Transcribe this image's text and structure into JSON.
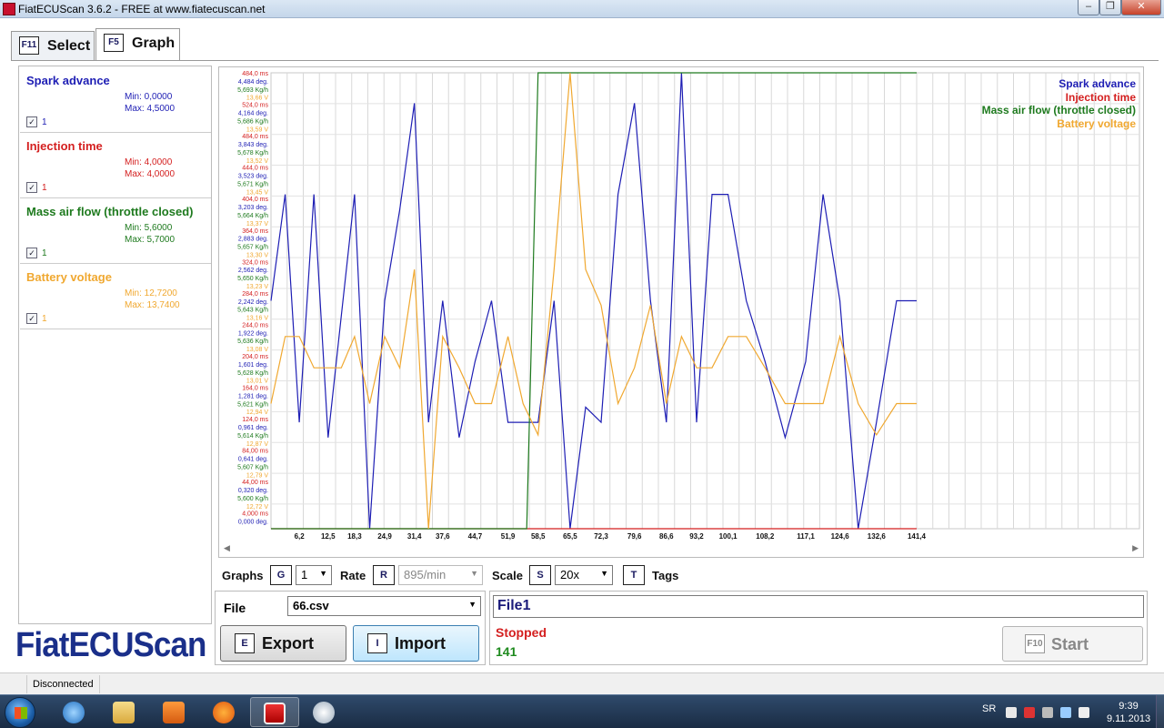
{
  "window": {
    "title": "FiatECUScan 3.6.2 - FREE at www.fiatecuscan.net"
  },
  "tabs": [
    {
      "key": "F11",
      "label": "Select"
    },
    {
      "key": "F5",
      "label": "Graph"
    }
  ],
  "signals": [
    {
      "name": "Spark advance",
      "min": "Min: 0,0000",
      "max": "Max: 4,5000",
      "checked": true,
      "count": "1",
      "color": "#1e1eb4"
    },
    {
      "name": "Injection time",
      "min": "Min: 4,0000",
      "max": "Max: 4,0000",
      "checked": true,
      "count": "1",
      "color": "#d41f1f"
    },
    {
      "name": "Mass air flow (throttle closed)",
      "min": "Min: 5,6000",
      "max": "Max: 5,7000",
      "checked": true,
      "count": "1",
      "color": "#1e7a1e"
    },
    {
      "name": "Battery voltage",
      "min": "Min: 12,7200",
      "max": "Max: 13,7400",
      "checked": true,
      "count": "1",
      "color": "#f0a830"
    }
  ],
  "chart_data": {
    "type": "line",
    "x": [
      0,
      3.1,
      6.2,
      9.4,
      12.5,
      15.4,
      18.3,
      21.6,
      24.9,
      28.2,
      31.4,
      34.5,
      37.6,
      41.2,
      44.7,
      48.3,
      51.9,
      55.2,
      58.5,
      62.0,
      65.5,
      68.9,
      72.3,
      76.0,
      79.6,
      83.1,
      86.6,
      89.9,
      93.2,
      96.6,
      100.1,
      104.1,
      108.2,
      112.6,
      117.1,
      120.9,
      124.6,
      128.6,
      132.6,
      137.0,
      141.4
    ],
    "x_ticks": [
      "6,2",
      "12,5",
      "18,3",
      "24,9",
      "31,4",
      "37,6",
      "44,7",
      "51,9",
      "58,5",
      "65,5",
      "72,3",
      "79,6",
      "86,6",
      "93,2",
      "100,1",
      "108,2",
      "117,1",
      "124,6",
      "132,6",
      "141,4"
    ],
    "series": [
      {
        "name": "Spark advance",
        "color": "#1e1eb4",
        "unit": "deg.",
        "values": [
          2.25,
          3.3,
          1.05,
          3.3,
          0.9,
          2.1,
          3.3,
          0.0,
          2.25,
          3.15,
          4.2,
          1.05,
          2.25,
          0.9,
          1.65,
          2.25,
          1.05,
          1.05,
          1.05,
          2.25,
          0.0,
          1.2,
          1.05,
          3.3,
          4.2,
          2.25,
          1.05,
          4.5,
          1.05,
          3.3,
          3.3,
          2.25,
          1.65,
          0.9,
          1.65,
          3.3,
          2.25,
          0.0,
          1.05,
          2.25,
          2.25
        ]
      },
      {
        "name": "Injection time",
        "color": "#d41f1f",
        "unit": "ms",
        "values": [
          4.0,
          4.0,
          4.0,
          4.0,
          4.0,
          4.0,
          4.0,
          4.0,
          4.0,
          4.0,
          4.0,
          4.0,
          4.0,
          4.0,
          4.0,
          4.0,
          4.0,
          4.0,
          4.0,
          4.0,
          4.0,
          4.0,
          4.0,
          4.0,
          4.0,
          4.0,
          4.0,
          4.0,
          4.0,
          4.0,
          4.0,
          4.0,
          4.0,
          4.0,
          4.0,
          4.0,
          4.0,
          4.0,
          4.0,
          4.0,
          4.0
        ]
      },
      {
        "name": "Mass air flow (throttle closed)",
        "color": "#1e7a1e",
        "unit": "Kg/h",
        "x": [
          0,
          16.0,
          54.6,
          56.0,
          58.5,
          141.4
        ],
        "values": [
          5.6,
          5.6,
          5.6,
          5.6,
          5.7,
          5.7
        ]
      },
      {
        "name": "Battery voltage",
        "color": "#f0a830",
        "unit": "V",
        "values": [
          13.0,
          13.15,
          13.15,
          13.08,
          13.08,
          13.08,
          13.15,
          13.0,
          13.15,
          13.08,
          13.3,
          12.72,
          13.15,
          13.08,
          13.0,
          13.0,
          13.15,
          13.0,
          12.93,
          13.3,
          13.74,
          13.3,
          13.22,
          13.0,
          13.08,
          13.22,
          13.0,
          13.15,
          13.08,
          13.08,
          13.15,
          13.15,
          13.08,
          13.0,
          13.0,
          13.0,
          13.15,
          13.0,
          12.93,
          13.0,
          13.0
        ]
      }
    ],
    "y_axis_labels": [
      [
        "484,0 ms",
        "4,484 deg.",
        "5,693 Kg/h",
        "13,66 V"
      ],
      [
        "524,0 ms",
        "4,164 deg.",
        "5,686 Kg/h",
        "13,59 V"
      ],
      [
        "484,0 ms",
        "3,843 deg.",
        "5,678 Kg/h",
        "13,52 V"
      ],
      [
        "444,0 ms",
        "3,523 deg.",
        "5,671 Kg/h",
        "13,45 V"
      ],
      [
        "404,0 ms",
        "3,203 deg.",
        "5,664 Kg/h",
        "13,37 V"
      ],
      [
        "364,0 ms",
        "2,883 deg.",
        "5,657 Kg/h",
        "13,30 V"
      ],
      [
        "324,0 ms",
        "2,562 deg.",
        "5,650 Kg/h",
        "13,23 V"
      ],
      [
        "284,0 ms",
        "2,242 deg.",
        "5,643 Kg/h",
        "13,16 V"
      ],
      [
        "244,0 ms",
        "1,922 deg.",
        "5,636 Kg/h",
        "13,08 V"
      ],
      [
        "204,0 ms",
        "1,601 deg.",
        "5,628 Kg/h",
        "13,01 V"
      ],
      [
        "164,0 ms",
        "1,281 deg.",
        "5,621 Kg/h",
        "12,94 V"
      ],
      [
        "124,0 ms",
        "0,961 deg.",
        "5,614 Kg/h",
        "12,87 V"
      ],
      [
        "84,00 ms",
        "0,641 deg.",
        "5,607 Kg/h",
        "12,79 V"
      ],
      [
        "44,00 ms",
        "0,320 deg.",
        "5,600 Kg/h",
        "12,72 V"
      ],
      [
        "4,000 ms",
        "0,000 deg."
      ]
    ],
    "legend_position": "top-right",
    "grid": true
  },
  "controls": {
    "graphs_label": "Graphs",
    "graphs_key": "G",
    "graphs_value": "1",
    "rate_label": "Rate",
    "rate_key": "R",
    "rate_value": "895/min",
    "scale_label": "Scale",
    "scale_key": "S",
    "scale_value": "20x",
    "tags_key": "T",
    "tags_label": "Tags"
  },
  "file": {
    "label": "File",
    "value": "66.csv"
  },
  "buttons": {
    "export_key": "E",
    "export_label": "Export",
    "import_key": "I",
    "import_label": "Import",
    "start_key": "F10",
    "start_label": "Start"
  },
  "status": {
    "file_name": "File1",
    "state": "Stopped",
    "count": "141"
  },
  "logo": "FiatECUScan",
  "statusbar": {
    "connection": "Disconnected"
  },
  "taskbar": {
    "lang": "SR",
    "time": "9:39",
    "date": "9.11.2013"
  },
  "icons": {
    "close": "close-icon",
    "minimize": "minimize-icon",
    "maximize": "maximize-icon",
    "start": "windows-start-icon",
    "ie": "internet-explorer-icon",
    "explorer": "folder-icon",
    "media": "media-player-icon",
    "firefox": "firefox-icon",
    "fiatecuscan": "fiatecuscan-icon",
    "paint": "paint-icon"
  }
}
